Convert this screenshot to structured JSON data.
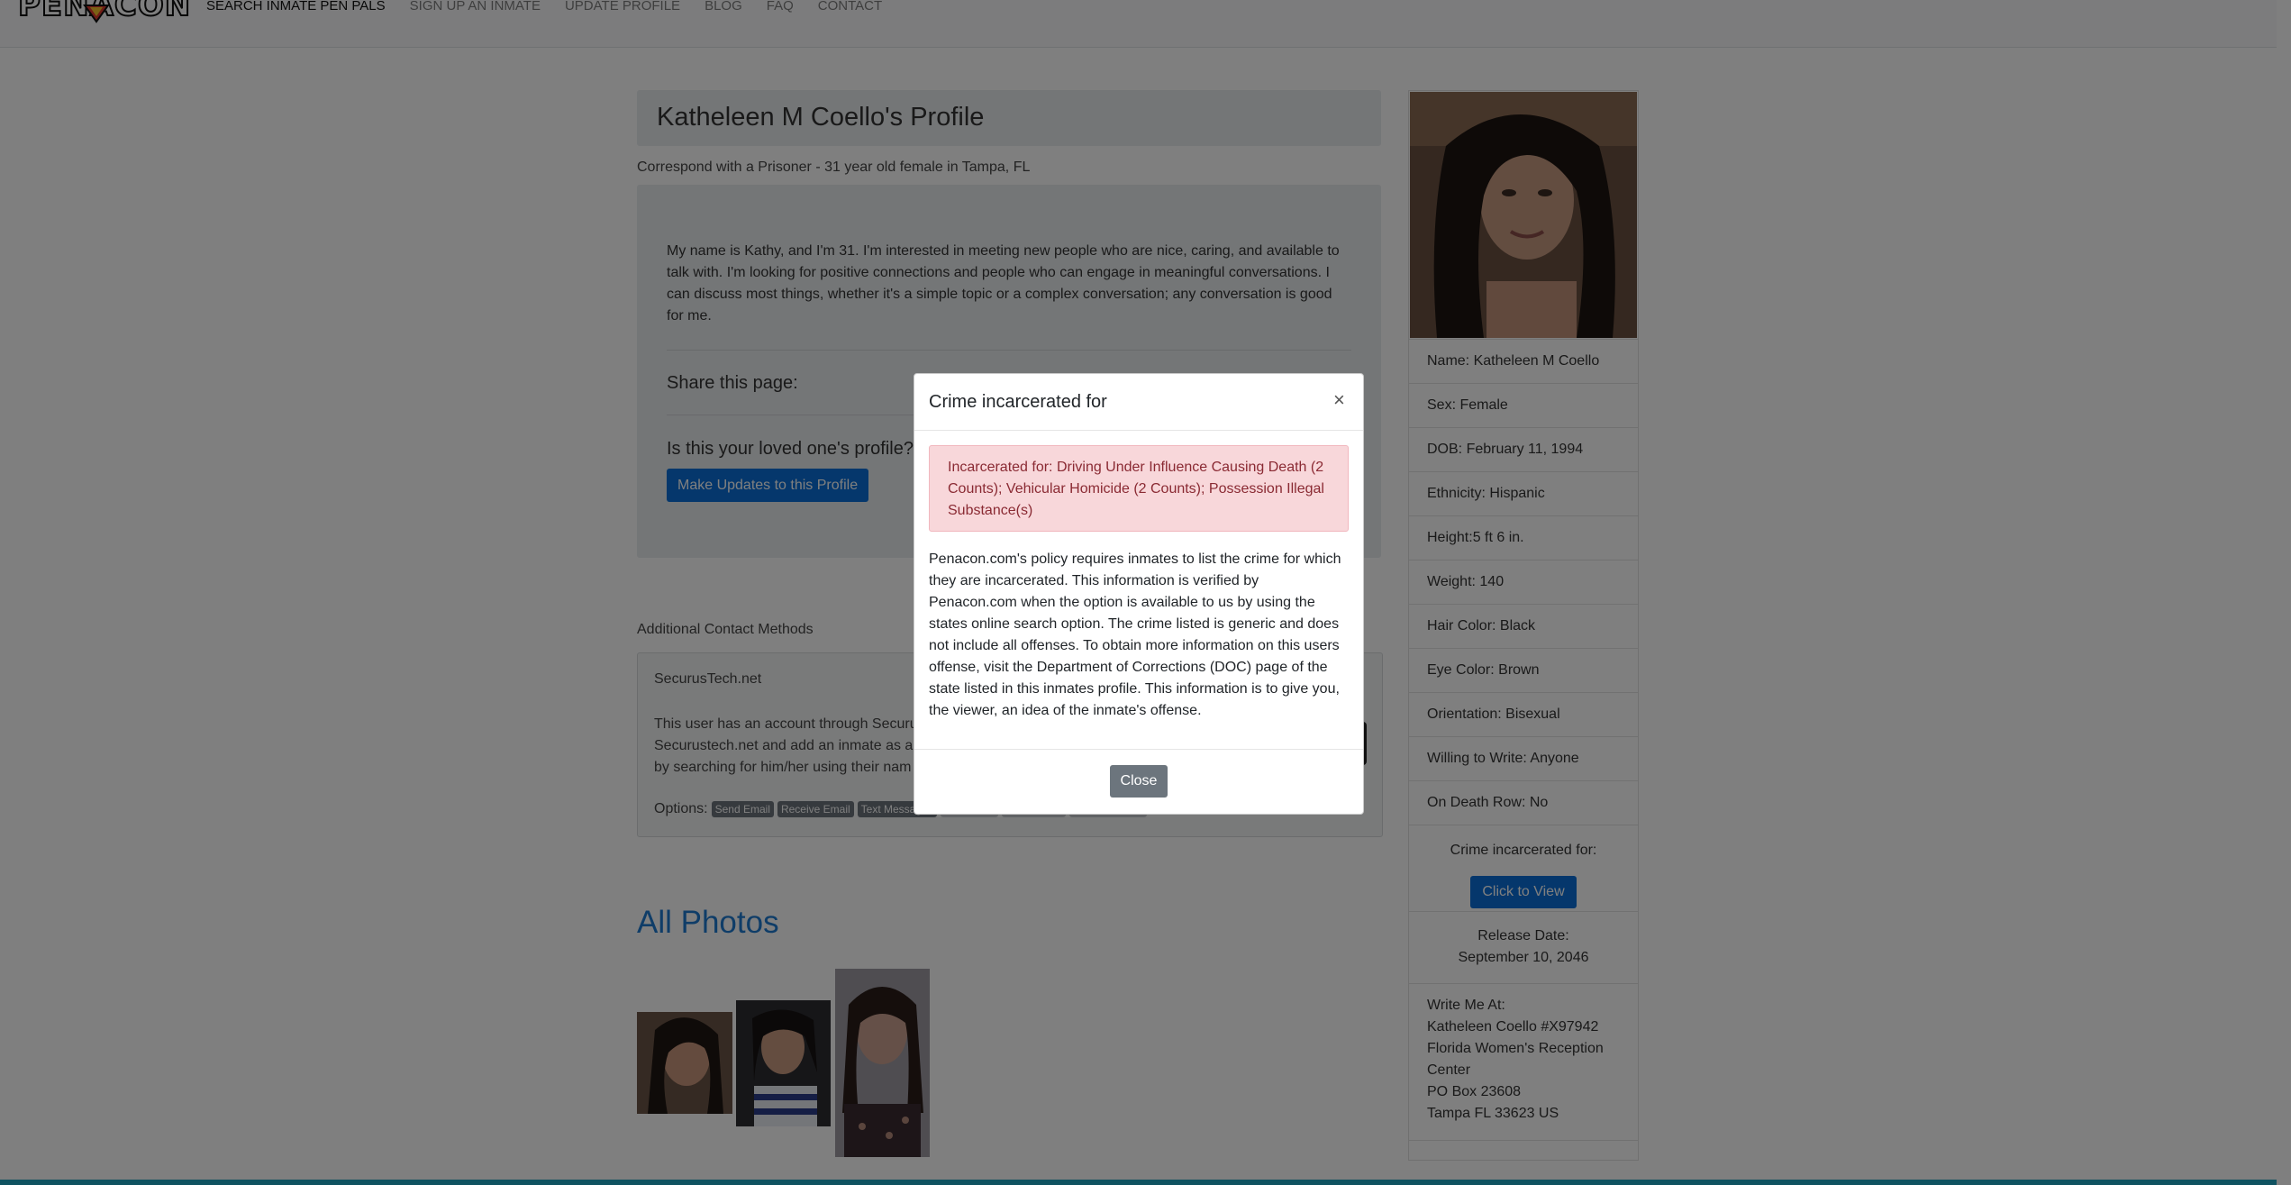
{
  "nav": {
    "logo_text": "PENACON",
    "links": [
      "SEARCH INMATE PEN PALS",
      "SIGN UP AN INMATE",
      "UPDATE PROFILE",
      "BLOG",
      "FAQ",
      "CONTACT"
    ]
  },
  "profile": {
    "title": "Katheleen M Coello's Profile",
    "subtitle": "Correspond with a Prisoner - 31 year old female in Tampa, FL",
    "bio": "My name is Kathy, and I'm 31. I'm interested in meeting new people who are nice, caring, and available to talk with. I'm looking for positive connections and people who can engage in meaningful conversations. I can discuss most things, whether it's a simple topic or a complex conversation; any conversation is good for me.",
    "share_label": "Share this page:",
    "loved_one_label": "Is this your loved one's profile?",
    "update_button": "Make Updates to this Profile"
  },
  "contact": {
    "section_label": "Additional Contact Methods",
    "securus_title": "SecurusTech.net",
    "securus_text_lines": [
      "This user has an account through Securus",
      "Securustech.net and add an inmate as a c",
      "by searching for him/her using their nam"
    ],
    "options_label": "Options:",
    "badges": [
      "Send Email",
      "Receive Email",
      "Text Messages",
      "Photo Mail",
      "Video Visits",
      "Phone Service"
    ]
  },
  "photos": {
    "title": "All Photos"
  },
  "sidebar": {
    "info": [
      "Name: Katheleen M Coello",
      "Sex: Female",
      "DOB: February 11, 1994",
      "Ethnicity: Hispanic",
      "Height:5 ft 6 in.",
      "Weight: 140",
      "Hair Color: Black",
      "Eye Color: Brown",
      "Orientation: Bisexual",
      "Willing to Write: Anyone",
      "On Death Row: No"
    ],
    "crime_label": "Crime incarcerated for:",
    "view_button": "Click to View",
    "release_label": "Release Date:",
    "release_date": "September 10, 2046",
    "write_label": "Write Me At:",
    "address": [
      "Katheleen Coello #X97942",
      "Florida Women's Reception",
      "Center",
      "PO Box 23608",
      "Tampa FL 33623 US"
    ]
  },
  "modal": {
    "title": "Crime incarcerated for",
    "close_x": "×",
    "alert": "Incarcerated for: Driving Under Influence Causing Death (2 Counts); Vehicular Homicide (2 Counts); Possession Illegal Substance(s)",
    "policy": "Penacon.com's policy requires inmates to list the crime for which they are incarcerated. This information is verified by Penacon.com when the option is available to us by using the states online search option. The crime listed is generic and does not include all offenses. To obtain more information on this users offense, visit the Department of Corrections (DOC) page of the state listed in this inmates profile. This information is to give you, the viewer, an idea of the inmate's offense.",
    "close_button": "Close"
  },
  "colors": {
    "primary": "#0a6fd8",
    "link": "#1f7bd1",
    "alert_bg": "#f8d7da",
    "alert_text": "#8a2a33",
    "secondary": "#6c757d",
    "footer": "#0f5260"
  }
}
